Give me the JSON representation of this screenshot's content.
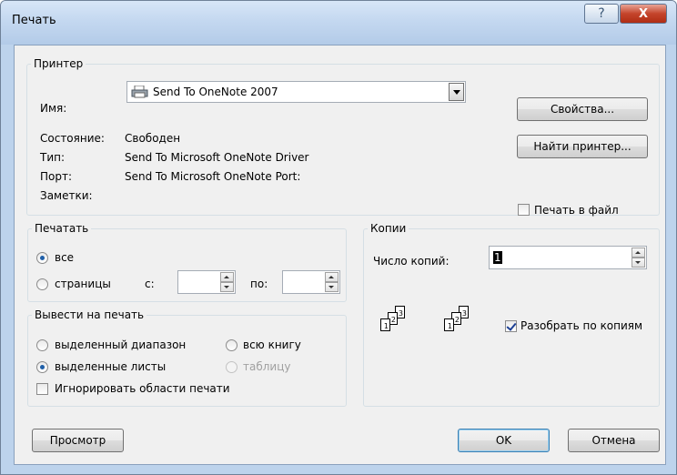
{
  "window": {
    "title": "Печать",
    "help_glyph": "?",
    "close_glyph": "X"
  },
  "printer": {
    "legend": "Принтер",
    "name_label": "Имя:",
    "name_value": "Send To OneNote 2007",
    "status_label": "Состояние:",
    "status_value": "Свободен",
    "type_label": "Тип:",
    "type_value": "Send To Microsoft OneNote Driver",
    "port_label": "Порт:",
    "port_value": "Send To Microsoft OneNote Port:",
    "notes_label": "Заметки:",
    "properties_button": "Свойства...",
    "find_printer_button": "Найти принтер...",
    "print_to_file_label": "Печать в файл",
    "print_to_file_checked": false,
    "printer_icon": "printer-icon"
  },
  "print_range": {
    "legend": "Печатать",
    "all_label": "все",
    "all_checked": true,
    "pages_label": "страницы",
    "from_label": "с:",
    "from_value": "",
    "to_label": "по:",
    "to_value": ""
  },
  "print_what": {
    "legend": "Вывести на печать",
    "selection_label": "выделенный диапазон",
    "workbook_label": "всю книгу",
    "active_sheets_label": "выделенные листы",
    "active_sheets_checked": true,
    "table_label": "таблицу",
    "ignore_print_areas_label": "Игнорировать области печати",
    "ignore_print_areas_checked": false
  },
  "copies": {
    "legend": "Копии",
    "count_label": "Число копий:",
    "count_value": "1",
    "collate_label": "Разобрать по копиям",
    "collate_checked": true,
    "page_numbers": [
      "1",
      "2",
      "3"
    ]
  },
  "footer": {
    "preview_button": "Просмотр",
    "ok_button": "OK",
    "cancel_button": "Отмена"
  }
}
